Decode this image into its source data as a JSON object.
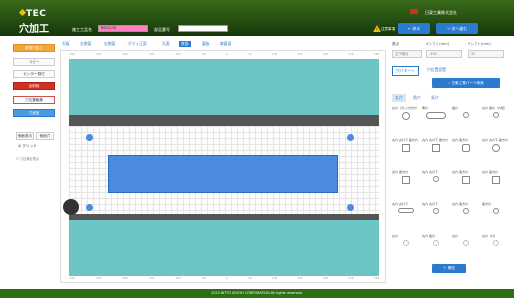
{
  "header": {
    "logo_small": "TEC",
    "logo_big": "穴加工",
    "field1_label": "施工工品名",
    "field1_value": "B620-06",
    "field2_label": "部品番号",
    "corp_name": "日東工業株式会社",
    "warning_text": "注意事項",
    "prev_label": "戻る",
    "next_label": "次へ進む"
  },
  "sidebar": {
    "items": [
      {
        "label": "新規穴加工",
        "style": "orange"
      },
      {
        "label": "コピー",
        "style": "plain"
      },
      {
        "label": "センター割付",
        "style": "plain"
      },
      {
        "label": "全削除",
        "style": "red"
      },
      {
        "label": "穴位置編集",
        "style": "bordered"
      },
      {
        "label": "穴追加",
        "style": "blue"
      }
    ],
    "view_buttons": [
      "側面表示",
      "側面穴"
    ],
    "checkbox_label": "グリッド",
    "checkbox2_label": "穴位置を表示"
  },
  "menu": {
    "items": [
      "天板",
      "左側面",
      "右側面",
      "ボディ正面",
      "天面",
      "底面",
      "裏板",
      "扉裏面"
    ],
    "active": 5
  },
  "canvas": {
    "ruler_ticks": [
      "-300",
      "-250",
      "-200",
      "-150",
      "-100",
      "-50",
      "0",
      "50",
      "100",
      "150",
      "200",
      "250",
      "300"
    ]
  },
  "right": {
    "label_base": "基点",
    "label_x": "Xシフト(mm)",
    "label_y": "Yシフト(mm)",
    "base_value": "左下基点",
    "x_value": "-333",
    "y_value": "37",
    "tab1": "穴パターン",
    "tab2": "穴位置設置",
    "search_btn": "日東工業パーツ検索",
    "sub_tabs": [
      "丸穴",
      "角穴",
      "長穴"
    ],
    "shapes": [
      "丸穴（ガック付穴）",
      "角穴",
      "長穴",
      "丸穴 長穴（穴径）",
      "丸穴 丸穴下 長方穴",
      "丸穴 丸穴下 長方穴",
      "丸穴 長方穴",
      "丸穴 丸穴下 長方穴",
      "丸穴 長方穴",
      "丸穴 丸穴下",
      "丸穴 長方穴",
      "丸穴 長方穴",
      "丸穴 丸穴下",
      "丸穴 丸穴下",
      "丸穴 長方穴",
      "長方穴",
      "丸穴",
      "丸穴 長穴",
      "丸穴",
      "丸穴（穴）"
    ],
    "ok_btn": "確定"
  },
  "footer": {
    "copyright": "2023 NITTO KOGYO CORPORATION All rights reserved."
  }
}
